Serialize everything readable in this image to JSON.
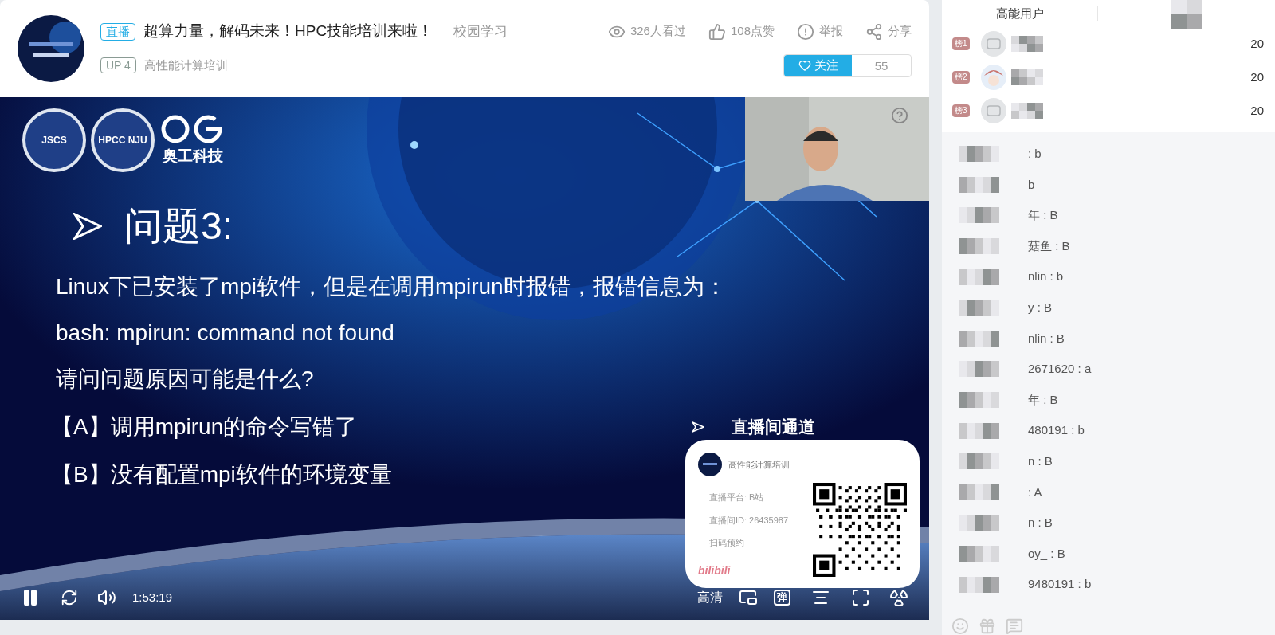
{
  "header": {
    "live_badge": "直播",
    "title": "超算力量，解码未来！HPC技能培训来啦！",
    "category": "校园学习",
    "up_badge": "UP 4",
    "channel": "高性能计算培训",
    "stats": [
      {
        "kind": "views",
        "text": "326人看过"
      },
      {
        "kind": "likes",
        "text": "108点赞"
      },
      {
        "kind": "report",
        "text": "举报"
      },
      {
        "kind": "share",
        "text": "分享"
      }
    ],
    "follow": {
      "label": "关注",
      "count": "55"
    }
  },
  "video": {
    "logos": [
      "JSCS",
      "HPCC NJU",
      "奥工科技"
    ],
    "heading": "问题3:",
    "lines": [
      "Linux下已安装了mpi软件，但是在调用mpirun时报错，报错信息为：",
      "bash: mpirun: command not found",
      "请问问题原因可能是什么?"
    ],
    "options": [
      "【A】调用mpirun的命令写错了",
      "【B】没有配置mpi软件的环境变量"
    ],
    "channel_heading": "直播间通道",
    "card": {
      "name": "高性能计算培训",
      "lines": [
        "直播平台: B站",
        "直播间ID: 26435987",
        "扫码预约"
      ],
      "brand": "bilibili"
    },
    "controls": {
      "playing": true,
      "time": "1:53:19",
      "quality": "高清",
      "danmaku": "弹"
    }
  },
  "sidebar": {
    "tab": "高能用户",
    "ranks": [
      {
        "badge": "榜1",
        "kind": "default",
        "score": "20"
      },
      {
        "badge": "榜2",
        "kind": "picture",
        "score": "20"
      },
      {
        "badge": "榜3",
        "kind": "default",
        "score": "20"
      }
    ],
    "chat": [
      ": b",
      "b",
      "年 : B",
      "菇鱼 : B",
      "nlin : b",
      "y : B",
      "nlin : B",
      "2671620 : a",
      "年 : B",
      "480191 : b",
      "n : B",
      ": A",
      "n : B",
      "oy_ : B",
      "9480191 : b"
    ]
  }
}
